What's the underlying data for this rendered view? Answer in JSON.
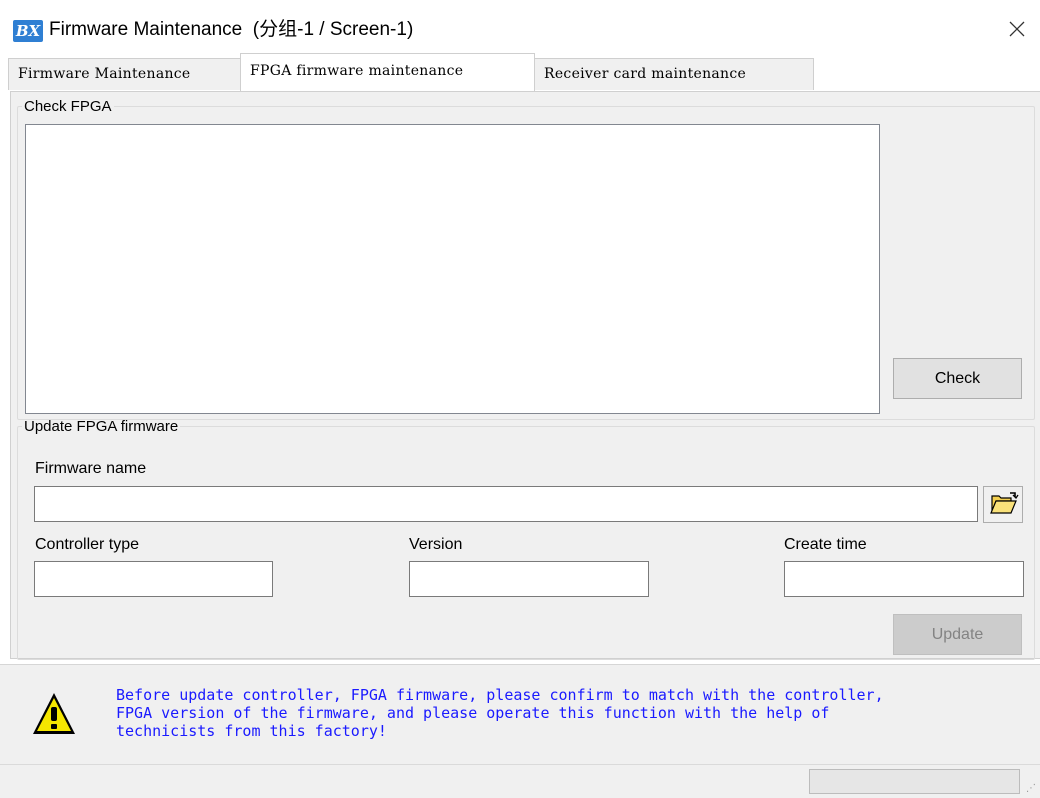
{
  "window": {
    "title": "Firmware Maintenance  (分组-1 / Screen-1)",
    "app_icon_text": "BX"
  },
  "tabs": [
    {
      "label": "Firmware Maintenance",
      "active": false
    },
    {
      "label": "FPGA firmware maintenance",
      "active": true
    },
    {
      "label": "Receiver card maintenance",
      "active": false
    }
  ],
  "check_fpga": {
    "legend": "Check FPGA",
    "output_text": "",
    "check_button": "Check"
  },
  "update_fpga": {
    "legend": "Update FPGA firmware",
    "firmware_name_label": "Firmware name",
    "firmware_name_value": "",
    "controller_type_label": "Controller type",
    "controller_type_value": "",
    "version_label": "Version",
    "version_value": "",
    "create_time_label": "Create time",
    "create_time_value": "",
    "update_button": "Update",
    "update_enabled": false
  },
  "warning": {
    "text": "Before update controller, FPGA firmware, please confirm to match with the controller,\nFPGA version of the firmware, and please operate this function with the help of\ntechnicists from this factory!",
    "color": "#1a1aff",
    "icon": "warning-icon"
  },
  "colors": {
    "panel_bg": "#f0f0f0",
    "warning_text": "#1a1aff",
    "app_icon": "#2f7fd3"
  }
}
